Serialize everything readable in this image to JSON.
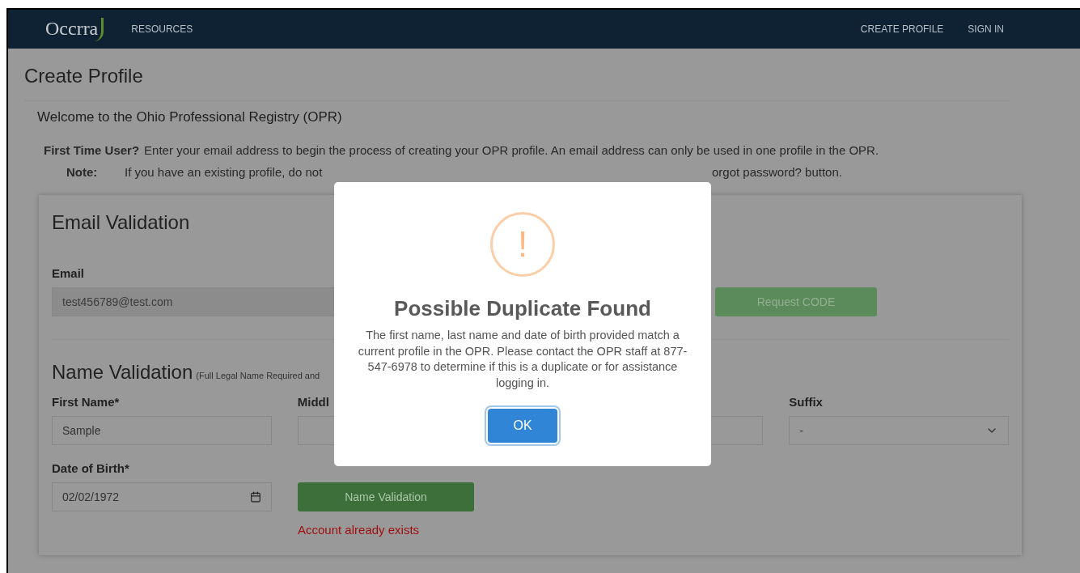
{
  "nav": {
    "logo_text": "Occrra",
    "left_links": [
      {
        "label": "RESOURCES"
      }
    ],
    "right_links": [
      {
        "label": "CREATE PROFILE"
      },
      {
        "label": "SIGN IN"
      }
    ]
  },
  "page_title": "Create Profile",
  "welcome": "Welcome to the Ohio Professional Registry (OPR)",
  "intro": {
    "label": "First Time User?",
    "text": "Enter your email address to begin the process of creating your OPR profile. An email address can only be used in one profile in the OPR."
  },
  "note": {
    "label": "Note:",
    "text_before": "If you have an existing profile, do not",
    "text_after": "orgot password? button."
  },
  "email_section": {
    "title": "Email Validation",
    "label": "Email",
    "value": "test456789@test.com",
    "disabled": true,
    "button": {
      "label": "Request CODE",
      "disabled": true
    }
  },
  "name_section": {
    "title": "Name Validation",
    "subtitle": "(Full Legal Name Required and",
    "fields": [
      {
        "label": "First Name*",
        "value": "Sample",
        "kind": "text"
      },
      {
        "label": "Middl",
        "kind": "text"
      },
      {
        "kind": "text"
      },
      {
        "label": "Suffix",
        "value": "-",
        "kind": "select"
      }
    ],
    "dob": {
      "label": "Date of Birth*",
      "value": "02/02/1972"
    },
    "button": {
      "label": "Name Validation",
      "disabled": false
    },
    "error": "Account already exists"
  },
  "modal": {
    "title": "Possible Duplicate Found",
    "message": "The first name, last name and date of birth provided match a current profile in the OPR. Please contact the OPR staff at 877-547-6978 to determine if this is a duplicate or for assistance logging in.",
    "icon": "!",
    "button": "OK"
  }
}
